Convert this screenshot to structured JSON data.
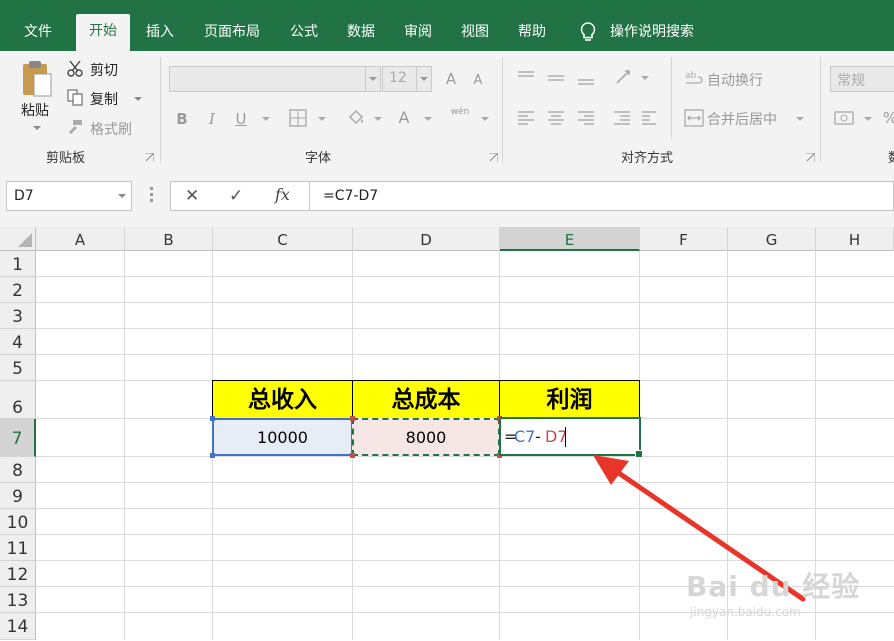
{
  "ribbon_tabs": [
    "文件",
    "开始",
    "插入",
    "页面布局",
    "公式",
    "数据",
    "审阅",
    "视图",
    "帮助"
  ],
  "active_tab": "开始",
  "search_label": "操作说明搜索",
  "clipboard": {
    "paste": "粘贴",
    "cut": "剪切",
    "copy": "复制",
    "format_painter": "格式刷",
    "group": "剪贴板"
  },
  "font": {
    "size": "12",
    "group": "字体",
    "bold": "B",
    "italic": "I",
    "underline": "U",
    "font_color": "A",
    "grow": "A",
    "shrink": "A",
    "phonetic": "wén"
  },
  "alignment": {
    "wrap": "自动换行",
    "merge": "合并后居中",
    "group": "对齐方式"
  },
  "number": {
    "format": "常规",
    "percent": "%",
    "group": "数"
  },
  "namebox": "D7",
  "formula_buttons": {
    "cancel": "✕",
    "enter": "✓",
    "fx": "fx"
  },
  "formula": "=C7-D7",
  "columns": [
    "A",
    "B",
    "C",
    "D",
    "E",
    "F",
    "G",
    "H"
  ],
  "selected_column": "E",
  "rows": [
    "1",
    "2",
    "3",
    "4",
    "5",
    "6",
    "7",
    "8",
    "9",
    "10",
    "11",
    "12",
    "13",
    "14"
  ],
  "selected_row": "7",
  "table": {
    "headers": [
      "总收入",
      "总成本",
      "利润"
    ],
    "values": [
      "10000",
      "8000"
    ],
    "editing_formula": {
      "eq": "=",
      "ref1": "C7",
      "op": "-",
      "ref2": "D7"
    }
  },
  "colors": {
    "excel_green": "#217346",
    "header_fill": "#ffff00",
    "ref_blue": "#4472c4",
    "ref_red": "#c0504d",
    "arrow": "#e8352a"
  },
  "watermark": {
    "brand": "Bai du 经验",
    "url": "jingyan.baidu.com"
  }
}
